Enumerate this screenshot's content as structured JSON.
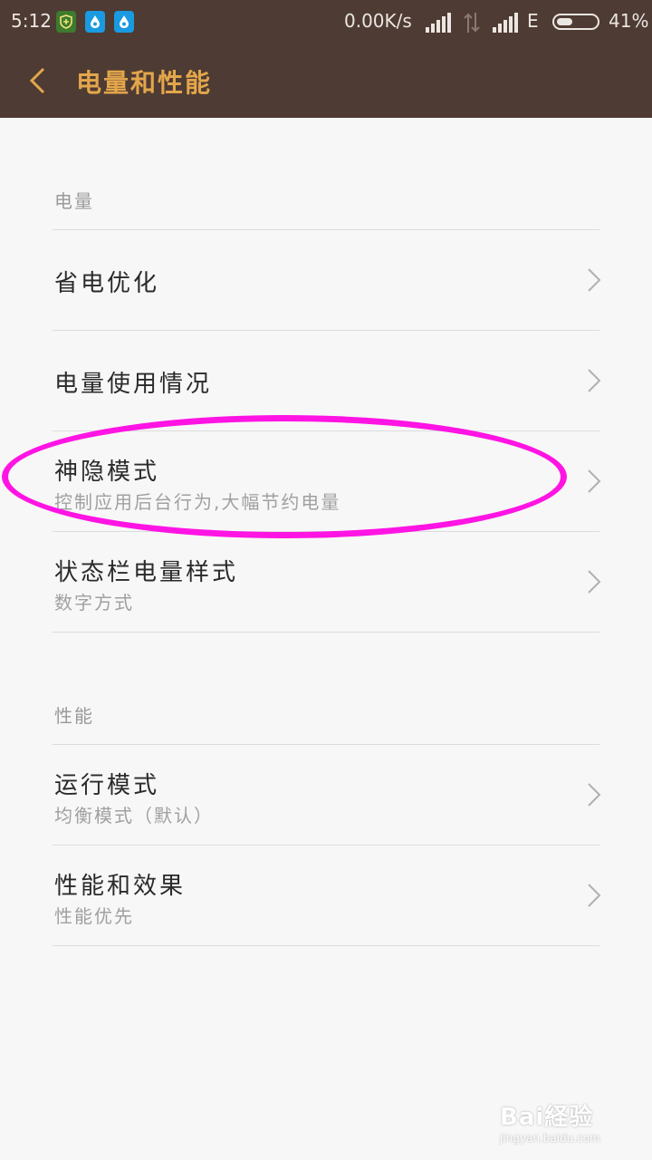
{
  "status_bar": {
    "time": "5:12",
    "net_speed": "0.00K/s",
    "network_type": "E",
    "battery_pct": "41%",
    "battery_level": 0.41,
    "icons": [
      "shield-icon",
      "drop-icon",
      "drop-icon",
      "signal-icon",
      "data-arrows-icon",
      "signal-icon",
      "battery-icon"
    ]
  },
  "header": {
    "title": "电量和性能",
    "back_icon": "back-arrow-icon"
  },
  "sections": [
    {
      "label": "电量",
      "items": [
        {
          "title": "省电优化",
          "subtitle": ""
        },
        {
          "title": "电量使用情况",
          "subtitle": ""
        },
        {
          "title": "神隐模式",
          "subtitle": "控制应用后台行为,大幅节约电量"
        },
        {
          "title": "状态栏电量样式",
          "subtitle": "数字方式"
        }
      ]
    },
    {
      "label": "性能",
      "items": [
        {
          "title": "运行模式",
          "subtitle": "均衡模式（默认）"
        },
        {
          "title": "性能和效果",
          "subtitle": "性能优先"
        }
      ]
    }
  ],
  "watermark": {
    "brand": "Bai経验",
    "url": "jingyan.baidu.com"
  },
  "colors": {
    "header_bg": "#4e3b33",
    "title": "#e3a64b",
    "highlight": "#ff14e4"
  }
}
